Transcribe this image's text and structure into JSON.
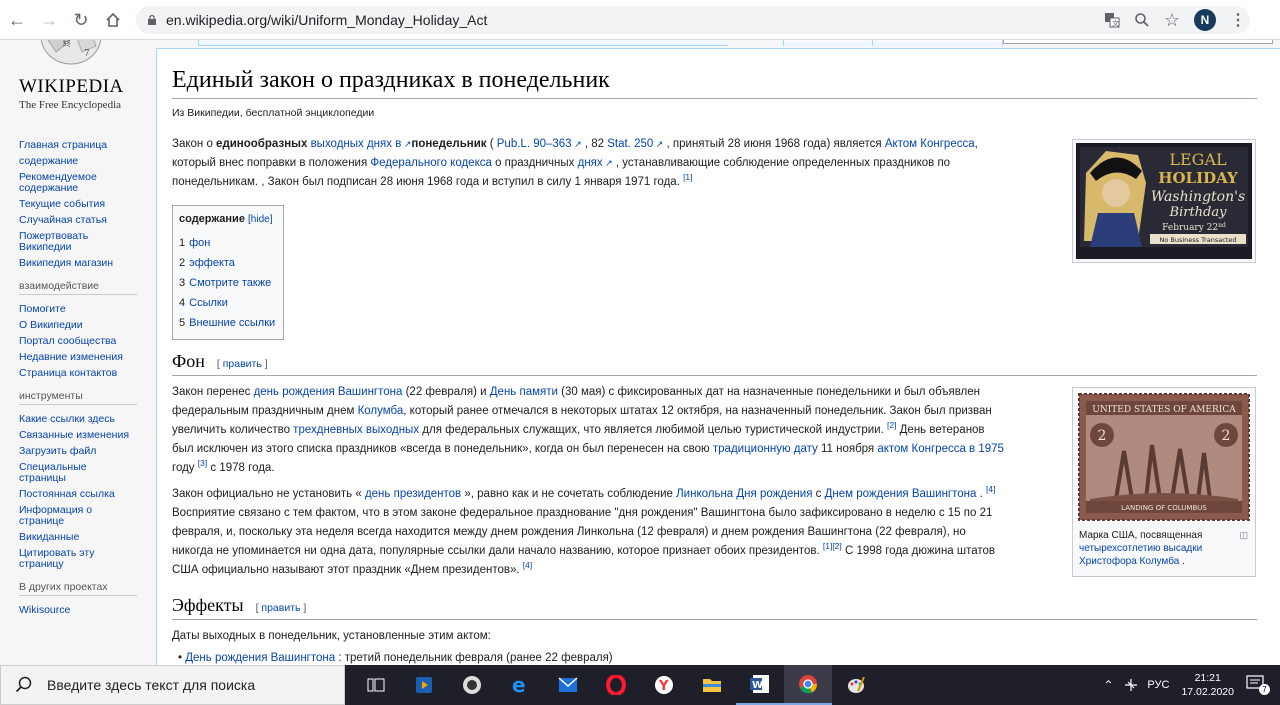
{
  "browser": {
    "url": "en.wikipedia.org/wiki/Uniform_Monday_Holiday_Act",
    "profile_initial": "N"
  },
  "logo": {
    "wordmark": "WIKIPEDIA",
    "tagline": "The Free Encyclopedia"
  },
  "sidebar": {
    "nav": [
      "Главная страница",
      "содержание",
      "Рекомендуемое содержание",
      "Текущие события",
      "Случайная статья",
      "Пожертвовать Википедии",
      "Википедия магазин"
    ],
    "interaction_heading": "взаимодействие",
    "interaction": [
      "Помогите",
      "О Википедии",
      "Портал сообщества",
      "Недавние изменения",
      "Страница контактов"
    ],
    "tools_heading": "инструменты",
    "tools": [
      "Какие ссылки здесь",
      "Связанные изменения",
      "Загрузить файл",
      "Специальные страницы",
      "Постоянная ссылка",
      "Информация о странице",
      "Викиданные",
      "Цитировать эту страницу"
    ],
    "projects_heading": "В других проектах",
    "projects": [
      "Wikisource"
    ]
  },
  "article": {
    "title": "Единый закон о праздниках в понедельник",
    "subtitle": "Из Википедии, бесплатной энциклопедии",
    "toc": {
      "title": "содержание",
      "hide": "[hide]",
      "items": [
        {
          "num": "1",
          "label": "фон"
        },
        {
          "num": "2",
          "label": "эффекта"
        },
        {
          "num": "3",
          "label": "Смотрите также"
        },
        {
          "num": "4",
          "label": "Ссылки"
        },
        {
          "num": "5",
          "label": "Внешние ссылки"
        }
      ]
    },
    "intro": {
      "p1a": "Закон о ",
      "b1": "единообразных",
      "l1": "выходных днях в",
      "b2": "понедельник",
      "p1b": " ( ",
      "l2": "Pub.L. 90–363",
      "p1c": " , 82 ",
      "l3": "Stat. 250",
      "p1d": " , принятый 28 июня 1968 года) является ",
      "l4": "Актом Конгресса",
      "p1e": ",",
      "p2a": "который внес поправки в положения ",
      "l5": "Федерального кодекса",
      "p2b": " о праздничных ",
      "l6": "днях",
      "p2c": " ,  устанавливающие соблюдение определенных праздников по",
      "p3": "понедельникам. , Закон был подписан 28 июня 1968 года и вступил в силу 1 января 1971 года. ",
      "ref": "[1]"
    },
    "section1": {
      "heading": "Фон",
      "edit_open": "[ ",
      "edit_label": "править",
      "edit_close": " ]",
      "para1": {
        "a": "Закон перенес ",
        "l1": "день рождения Вашингтона",
        "b": " (22 февраля) и ",
        "l2": "День памяти",
        "c": " (30 мая) с фиксированных дат на назначенные понедельники и был объявлен",
        "d": "федеральным праздничным днем ",
        "l3": "Колумба",
        "e": ", который ранее отмечался в некоторых штатах 12 октября, на назначенный понедельник. Закон был призван",
        "f": "увеличить количество ",
        "l4": "трехдневных выходных",
        "g": " для федеральных служащих, что является любимой целью туристической индустрии. ",
        "r1": "[2]",
        "h": " День ветеранов",
        "i": "был исключен из этого списка праздников «всегда в понедельник», когда он был перенесен на свою ",
        "l5": "традиционную дату",
        "j": " 11 ноября ",
        "l6": "актом Конгресса в 1975",
        "k": "году ",
        "r2": "[3]",
        "m": " с 1978 года."
      },
      "para2": {
        "a": "Закон официально не установить « ",
        "l1": "день президентов",
        "b": " », равно как и не сочетать соблюдение ",
        "l2": "Линкольна Дня рождения",
        "c": " с ",
        "l3": "Днем рождения Вашингтона",
        "d": " . ",
        "r1": "[4]",
        "e": "Восприятие связано с тем фактом, что в этом законе федеральное празднование \"дня рождения\" Вашингтона было зафиксировано в неделю с 15 по 21",
        "f": "февраля, и, поскольку эта неделя всегда находится между днем рождения Линкольна (12 февраля) и днем рождения Вашингтона (22 февраля), но",
        "g": "никогда не упоминается ни одна дата, популярные ссылки дали начало названию, которое признает обоих президентов. ",
        "r2": "[1]",
        "r3": "[2]",
        "h": " С 1998 года дюжина штатов",
        "i": "США официально называют этот праздник «Днем президентов». ",
        "r4": "[4]"
      }
    },
    "section2": {
      "heading": "Эффекты",
      "edit_open": "[ ",
      "edit_label": "править",
      "edit_close": " ]",
      "intro": "Даты выходных в понедельник, установленные этим актом:",
      "bullet_link": "День рождения Вашингтона",
      "bullet_rest": " : третий понедельник февраля (ранее 22 февраля)"
    },
    "poster": {
      "line1": "LEGAL",
      "line2": "HOLIDAY",
      "line3": "Washington's",
      "line4": "Birthday",
      "line5": "February 22",
      "line5_sup": "nd",
      "line6": "No Business Transacted"
    },
    "stamp": {
      "top": "UNITED STATES OF AMERICA",
      "value": "2",
      "bottom": "LANDING OF COLUMBUS",
      "caption_a": "Марка США, посвященная",
      "caption_link": "четырехсотлетию высадки Христофора Колумба",
      "caption_b": " ."
    }
  },
  "taskbar": {
    "search_placeholder": "Введите здесь текст для поиска",
    "lang": "РУС",
    "time": "21:21",
    "date": "17.02.2020",
    "notifications": "7"
  }
}
